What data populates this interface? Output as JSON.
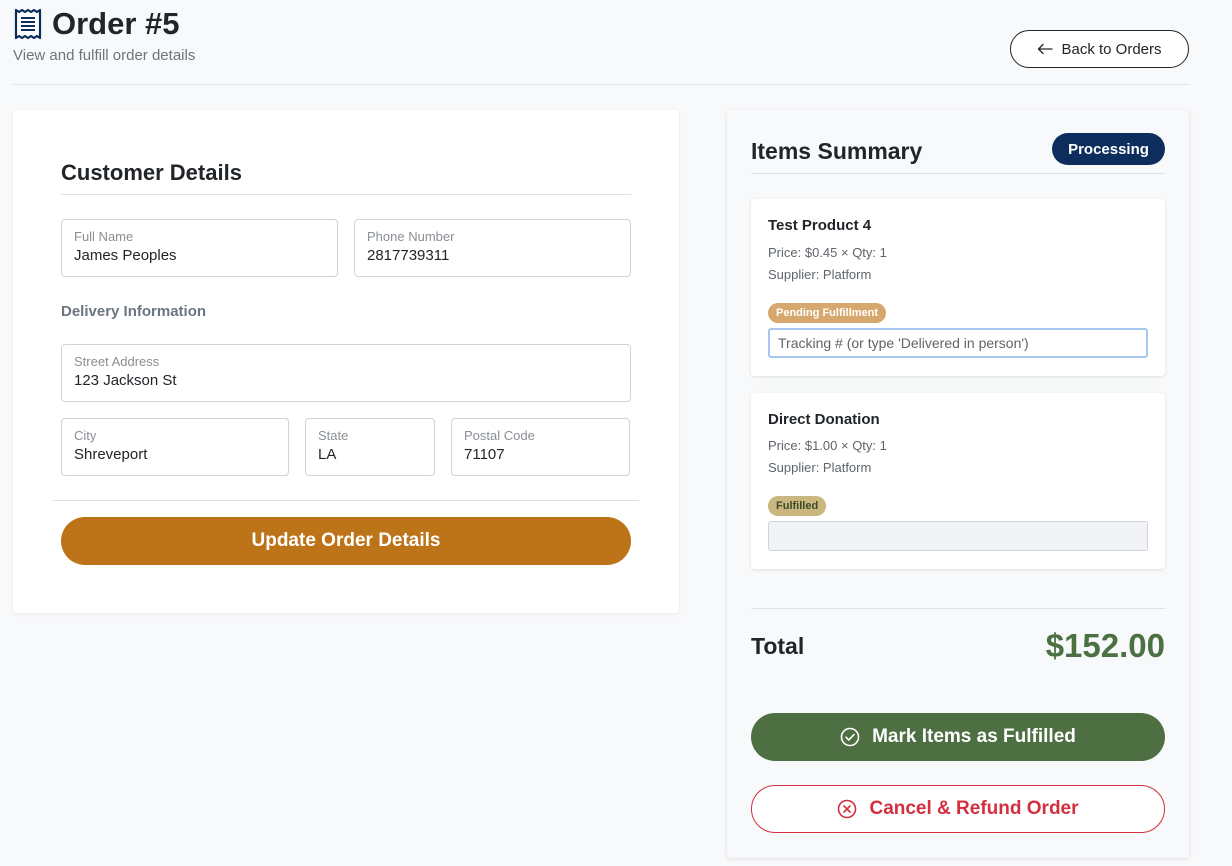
{
  "header": {
    "title": "Order #5",
    "subtitle": "View and fulfill order details",
    "back_label": "Back to Orders",
    "icon": "receipt-icon"
  },
  "customer": {
    "section_title": "Customer Details",
    "full_name_label": "Full Name",
    "full_name": "James Peoples",
    "phone_label": "Phone Number",
    "phone": "2817739311",
    "delivery_heading": "Delivery Information",
    "street_label": "Street Address",
    "street": "123 Jackson St",
    "city_label": "City",
    "city": "Shreveport",
    "state_label": "State",
    "state": "LA",
    "postal_label": "Postal Code",
    "postal": "71107",
    "update_label": "Update Order Details"
  },
  "summary": {
    "title": "Items Summary",
    "status": "Processing",
    "items": [
      {
        "name": "Test Product 4",
        "price_qty": "Price: $0.45 × Qty: 1",
        "supplier": "Supplier: Platform",
        "badge": "Pending Fulfillment",
        "tracking_placeholder": "Tracking # (or type 'Delivered in person')",
        "tracking_value": ""
      },
      {
        "name": "Direct Donation",
        "price_qty": "Price: $1.00 × Qty: 1",
        "supplier": "Supplier: Platform",
        "badge": "Fulfilled",
        "tracking_placeholder": "",
        "tracking_value": ""
      }
    ],
    "total_label": "Total",
    "total_value": "$152.00",
    "fulfill_label": "Mark Items as Fulfilled",
    "cancel_label": "Cancel & Refund Order"
  },
  "colors": {
    "accent_orange": "#bd7318",
    "status_navy": "#0d2e5c",
    "success_green": "#4d6f42",
    "danger_red": "#d32f3f",
    "pending_badge": "#d7a86e",
    "fulfilled_badge": "#c9b77f"
  }
}
